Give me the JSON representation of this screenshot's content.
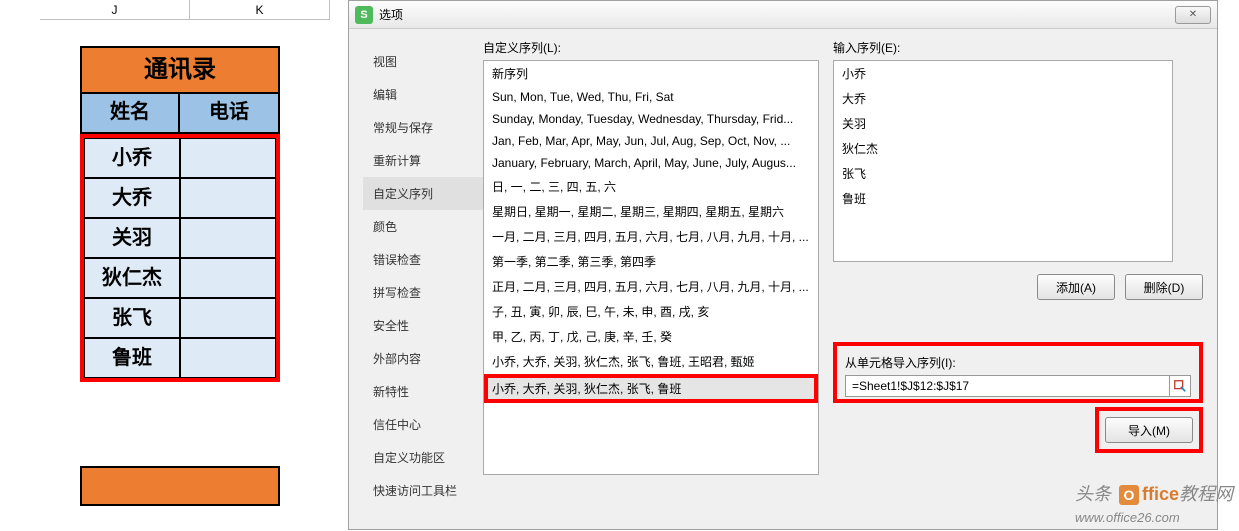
{
  "sheet": {
    "col_headers": [
      "J",
      "K"
    ],
    "table_title": "通讯录",
    "header_name": "姓名",
    "header_phone": "电话",
    "rows": [
      "小乔",
      "大乔",
      "关羽",
      "狄仁杰",
      "张飞",
      "鲁班"
    ]
  },
  "dialog": {
    "title": "选项",
    "close_glyph": "✕",
    "nav": {
      "view": "视图",
      "edit": "编辑",
      "general_save": "常规与保存",
      "recalc": "重新计算",
      "custom_list": "自定义序列",
      "color": "颜色",
      "error_check": "错误检查",
      "spell_check": "拼写检查",
      "security": "安全性",
      "external": "外部内容",
      "new_feature": "新特性",
      "trust_center": "信任中心",
      "custom_func": "自定义功能区",
      "quick_access": "快速访问工具栏"
    },
    "custom_list_label": "自定义序列(L):",
    "custom_lists": [
      "新序列",
      "Sun, Mon, Tue, Wed, Thu, Fri, Sat",
      "Sunday, Monday, Tuesday, Wednesday, Thursday, Frid...",
      "Jan, Feb, Mar, Apr, May, Jun, Jul, Aug, Sep, Oct, Nov, ...",
      "January, February, March, April, May, June, July, Augus...",
      "日, 一, 二, 三, 四, 五, 六",
      "星期日, 星期一, 星期二, 星期三, 星期四, 星期五, 星期六",
      "一月, 二月, 三月, 四月, 五月, 六月, 七月, 八月, 九月, 十月, ...",
      "第一季, 第二季, 第三季, 第四季",
      "正月, 二月, 三月, 四月, 五月, 六月, 七月, 八月, 九月, 十月, ...",
      "子, 丑, 寅, 卯, 辰, 巳, 午, 未, 申, 酉, 戌, 亥",
      "甲, 乙, 丙, 丁, 戊, 己, 庚, 辛, 壬, 癸",
      "小乔, 大乔, 关羽, 狄仁杰, 张飞, 鲁班, 王昭君, 甄姬"
    ],
    "custom_list_selected": "小乔, 大乔, 关羽, 狄仁杰, 张飞, 鲁班",
    "input_seq_label": "输入序列(E):",
    "input_seq_items": [
      "小乔",
      "大乔",
      "关羽",
      "狄仁杰",
      "张飞",
      "鲁班"
    ],
    "btn_add": "添加(A)",
    "btn_delete": "删除(D)",
    "import_label": "从单元格导入序列(I):",
    "import_value": "=Sheet1!$J$12:$J$17",
    "btn_import": "导入(M)"
  },
  "watermark": {
    "prefix": "头条",
    "brand1": "ffice",
    "brand2": "教程网",
    "url": "www.office26.com"
  }
}
